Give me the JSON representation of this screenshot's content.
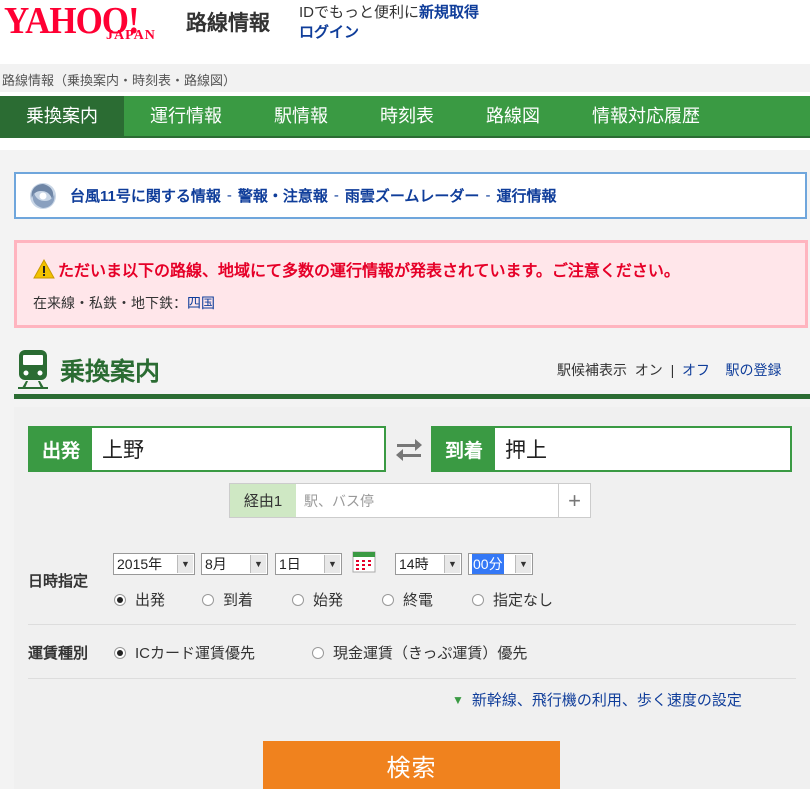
{
  "header": {
    "logo_text": "YAHOO!",
    "logo_sub": "JAPAN",
    "service_name": "路線情報",
    "id_promo_text": "IDでもっと便利に",
    "id_promo_link": "新規取得",
    "login_link": "ログイン"
  },
  "breadcrumb": "路線情報（乗換案内・時刻表・路線図）",
  "nav": {
    "tabs": [
      {
        "label": "乗換案内",
        "active": true
      },
      {
        "label": "運行情報"
      },
      {
        "label": "駅情報"
      },
      {
        "label": "時刻表"
      },
      {
        "label": "路線図"
      },
      {
        "label": "情報対応履歴"
      }
    ]
  },
  "typhoon": {
    "links": [
      "台風11号に関する情報",
      "警報・注意報",
      "雨雲ズームレーダー",
      "運行情報"
    ],
    "separator": "-"
  },
  "alert": {
    "message": "ただいま以下の路線、地域にて多数の運行情報が発表されています。ご注意ください。",
    "line_label": "在来線・私鉄・地下鉄：",
    "line_link": "四国"
  },
  "section": {
    "title": "乗換案内",
    "suggest_label": "駅候補表示",
    "suggest_on": "オン",
    "suggest_sep": "|",
    "suggest_off": "オフ",
    "register_link": "駅の登録"
  },
  "form": {
    "from_label": "出発",
    "from_value": "上野",
    "to_label": "到着",
    "to_value": "押上",
    "via_label": "経由1",
    "via_placeholder": "駅、バス停",
    "datetime_label": "日時指定",
    "year": "2015年",
    "month": "8月",
    "day": "1日",
    "hour": "14時",
    "minute": "00分",
    "time_options": [
      {
        "label": "出発",
        "checked": true
      },
      {
        "label": "到着"
      },
      {
        "label": "始発"
      },
      {
        "label": "終電"
      },
      {
        "label": "指定なし"
      }
    ],
    "fare_label": "運賃種別",
    "fare_options": [
      {
        "label": "ICカード運賃優先",
        "checked": true
      },
      {
        "label": "現金運賃（きっぷ運賃）優先"
      }
    ],
    "advanced_link": "新幹線、飛行機の利用、歩く速度の設定",
    "search_button": "検索"
  },
  "colors": {
    "green": "#3a9a43",
    "dark_green": "#2b6c33",
    "link_blue": "#0f3d9a",
    "alert_red": "#e60028",
    "search_orange": "#f0821e"
  }
}
